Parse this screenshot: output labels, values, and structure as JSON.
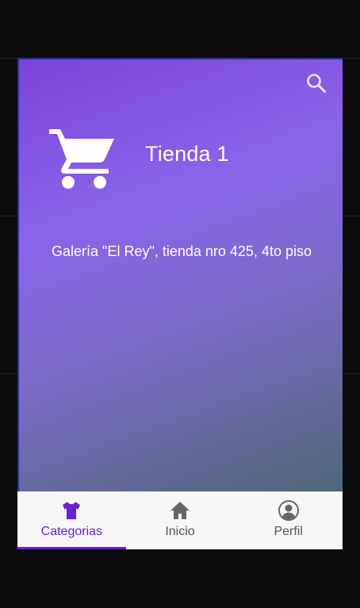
{
  "store": {
    "title": "Tienda 1",
    "address": "Galería \"El Rey\", tienda nro 425, 4to piso"
  },
  "header": {
    "search_icon": "search-icon"
  },
  "colors": {
    "accent": "#6a1fd8",
    "gradient_start": "#7a44d9",
    "gradient_mid": "#8a63ea",
    "gradient_end": "#4f6777",
    "nav_bg": "#f7f7f7"
  },
  "bottom_nav": {
    "items": [
      {
        "label": "Categorias",
        "icon": "tshirt-icon",
        "active": true
      },
      {
        "label": "Inicio",
        "icon": "home-icon",
        "active": false
      },
      {
        "label": "Perfil",
        "icon": "profile-icon",
        "active": false
      }
    ]
  }
}
